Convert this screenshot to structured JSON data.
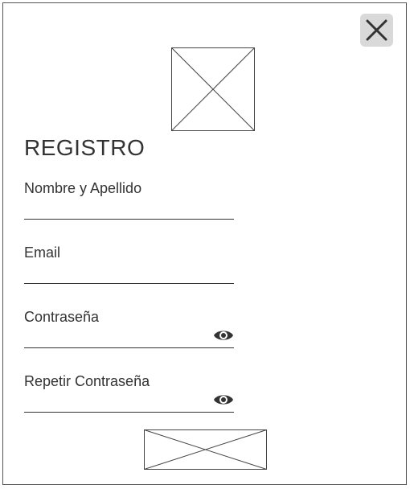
{
  "colors": {
    "text": "#333333",
    "frame_border": "#555555",
    "close_button_bg": "#d9d9d9",
    "close_icon": "#333333",
    "placeholder_stroke": "#444444"
  },
  "icons": {
    "close": "close-icon",
    "password_toggle": "eye-icon",
    "logo": "image-placeholder-icon",
    "submit": "image-placeholder-icon"
  },
  "form": {
    "title": "REGISTRO",
    "fields": [
      {
        "label": "Nombre y Apellido",
        "value": "",
        "has_visibility_toggle": false
      },
      {
        "label": "Email",
        "value": "",
        "has_visibility_toggle": false
      },
      {
        "label": "Contraseña",
        "value": "",
        "has_visibility_toggle": true
      },
      {
        "label": "Repetir Contraseña",
        "value": "",
        "has_visibility_toggle": true
      }
    ]
  }
}
